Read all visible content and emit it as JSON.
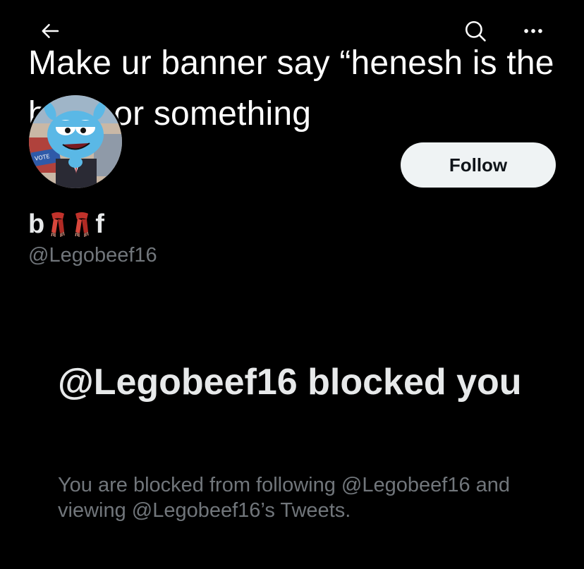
{
  "banner": {
    "text": "Make ur banner say “henesh is the best” or something"
  },
  "topbar": {
    "back_icon": "arrow-left-icon",
    "search_icon": "search-icon",
    "more_icon": "more-horizontal-icon"
  },
  "profile": {
    "display_name_start": "b",
    "display_name_end": "f",
    "name_emoji": "scarf-icon",
    "handle": "@Legobeef16",
    "follow_label": "Follow"
  },
  "blocked": {
    "title": "@Legobeef16 blocked you",
    "message": "You are blocked from following @Legobeef16 and viewing @Legobeef16’s Tweets."
  },
  "colors": {
    "background": "#000000",
    "primary_text": "#e7e9ea",
    "secondary_text": "#71767b",
    "follow_bg": "#eff3f4"
  }
}
